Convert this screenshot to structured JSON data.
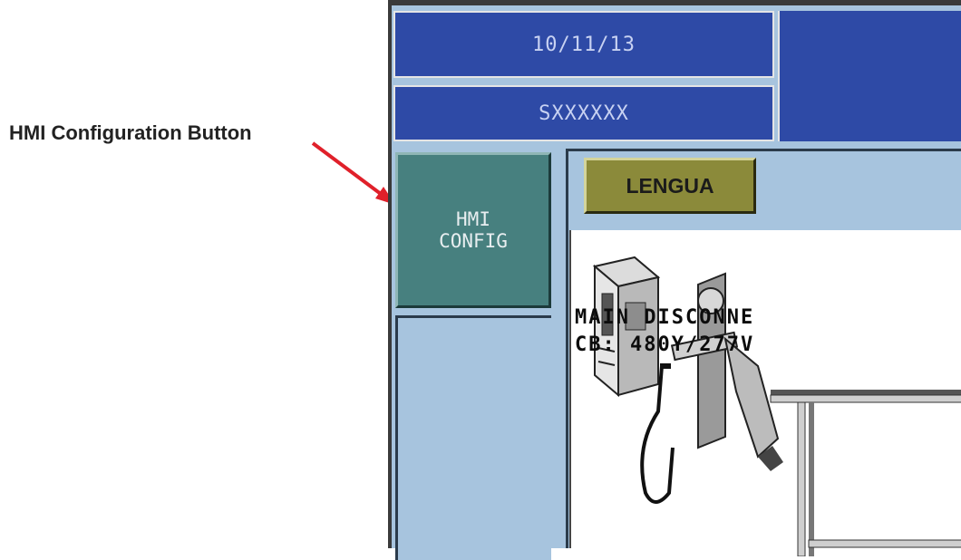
{
  "callout": {
    "label": "HMI Configuration Button"
  },
  "header": {
    "date": "10/11/13",
    "serial": "SXXXXXX"
  },
  "sidebar": {
    "config_button_line1": "HMI",
    "config_button_line2": "CONFIG"
  },
  "toolbar": {
    "language_button": "LENGUA"
  },
  "main": {
    "disconnect_line1": "MAIN DISCONNE",
    "disconnect_line2": "CB: 480Y/277V"
  },
  "colors": {
    "header_blue": "#2e4aa6",
    "panel_light_blue": "#a7c4de",
    "config_teal": "#47807f",
    "language_olive": "#8b8a3a",
    "arrow_red": "#e0202a"
  }
}
